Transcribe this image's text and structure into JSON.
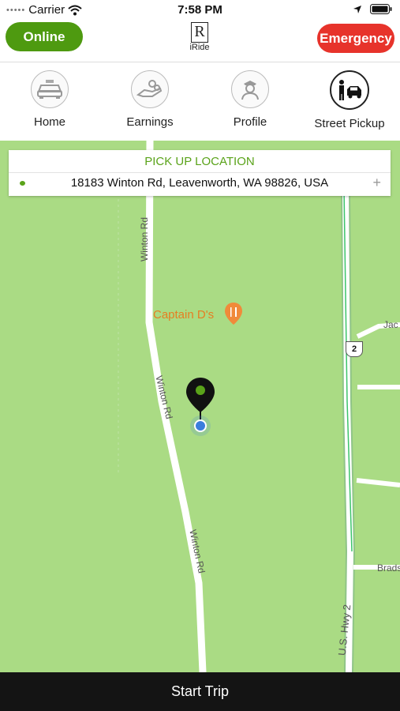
{
  "status": {
    "carrier": "Carrier",
    "time": "7:58 PM"
  },
  "topbar": {
    "online_label": "Online",
    "emergency_label": "Emergency",
    "logo_letter": "R",
    "logo_text": "iRide"
  },
  "nav": {
    "items": [
      {
        "label": "Home",
        "icon": "taxi-icon"
      },
      {
        "label": "Earnings",
        "icon": "hand-coins-icon"
      },
      {
        "label": "Profile",
        "icon": "driver-profile-icon"
      },
      {
        "label": "Street Pickup",
        "icon": "street-pickup-icon",
        "active": true
      }
    ]
  },
  "pickup": {
    "title": "PICK UP LOCATION",
    "address": "18183 Winton Rd, Leavenworth, WA 98826, USA",
    "add_symbol": "+"
  },
  "map": {
    "labels": {
      "road1": "Winton Rd",
      "road2": "Winton Rd",
      "road3": "Winton Rd",
      "poi": "Captain D's",
      "highway_shield": "2",
      "highway": "U.S. Hwy 2",
      "side1": "Jac",
      "side2": "Brads"
    },
    "colors": {
      "land": "#aadb84",
      "road": "#ffffff",
      "poi": "#e67e22",
      "pin": "#111111",
      "pin_dot": "#5aa31a",
      "current_location": "#3b7ddd"
    }
  },
  "bottom": {
    "start_trip_label": "Start Trip"
  },
  "colors": {
    "online": "#4e9a10",
    "emergency": "#e7332b",
    "accent_green": "#5aa31a",
    "bottom_bar": "#141414"
  }
}
